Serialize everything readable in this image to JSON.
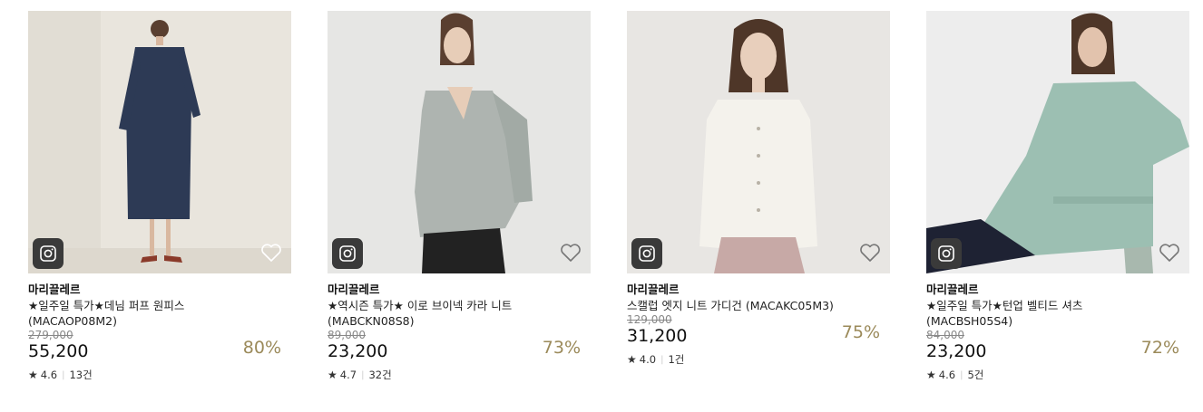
{
  "products": [
    {
      "brand": "마리끌레르",
      "name_line1": "★일주일 특가★데님 퍼프 원피스",
      "name_line2": "(MACAOP08M2)",
      "original_price": "279,000",
      "price": "55,200",
      "discount": "80%",
      "rating": "4.6",
      "reviews": "13건",
      "colors": {
        "bg": "#e9e5dd",
        "garment": "#2d3a55",
        "accent": "#8a3a2a"
      }
    },
    {
      "brand": "마리끌레르",
      "name_line1": "★역시즌 특가★ 이로 브이넥 카라 니트",
      "name_line2": "(MABCKN08S8)",
      "original_price": "89,000",
      "price": "23,200",
      "discount": "73%",
      "rating": "4.7",
      "reviews": "32건",
      "colors": {
        "bg": "#e6e6e4",
        "garment": "#aeb4b0",
        "accent": "#222222"
      }
    },
    {
      "brand": "마리끌레르",
      "name_line1": "스캘럽 엣지 니트 가디건 (MACAKC05M3)",
      "name_line2": "",
      "original_price": "129,000",
      "price": "31,200",
      "discount": "75%",
      "rating": "4.0",
      "reviews": "1건",
      "colors": {
        "bg": "#e8e6e3",
        "garment": "#f4f2ec",
        "accent": "#c7a9a6"
      }
    },
    {
      "brand": "마리끌레르",
      "name_line1": "★일주일 특가★턴업 벨티드 셔츠",
      "name_line2": "(MACBSH05S4)",
      "original_price": "84,000",
      "price": "23,200",
      "discount": "72%",
      "rating": "4.6",
      "reviews": "5건",
      "colors": {
        "bg": "#ededed",
        "garment": "#9cbfb2",
        "accent": "#1e2233"
      }
    }
  ]
}
